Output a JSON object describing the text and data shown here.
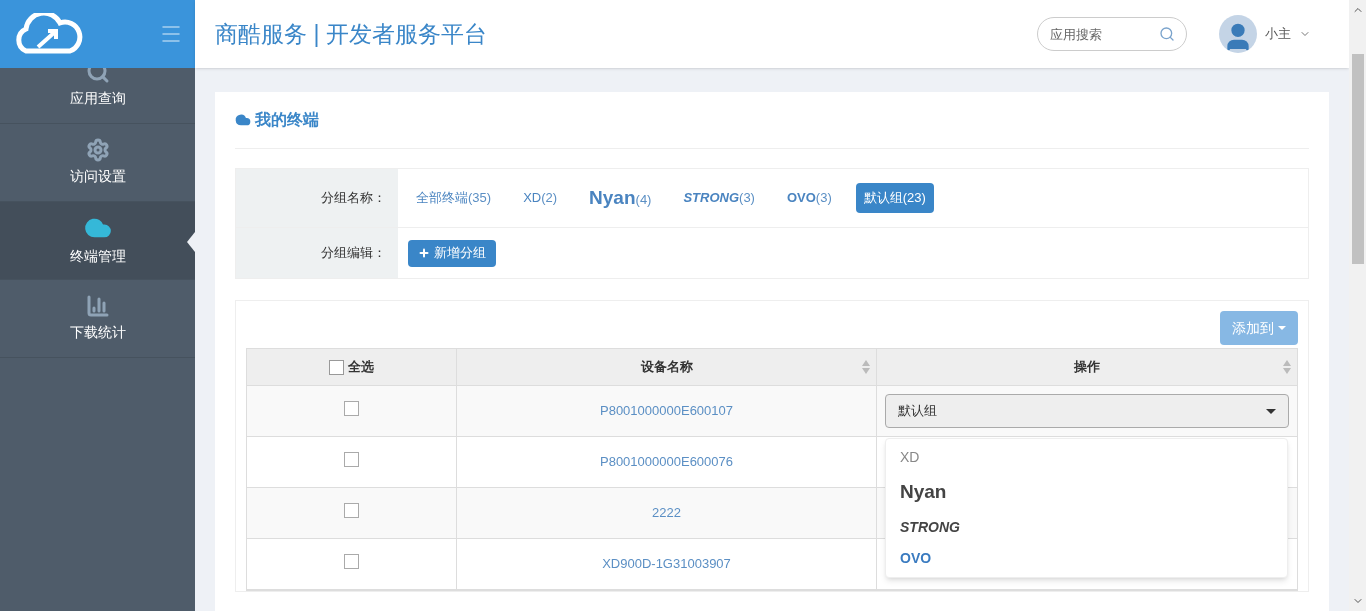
{
  "header": {
    "title": "商酷服务 | 开发者服务平台",
    "search": {
      "placeholder": "应用搜索"
    },
    "user": {
      "name": "小主"
    }
  },
  "sidebar": {
    "items": [
      {
        "label": "应用查询",
        "selected": false
      },
      {
        "label": "访问设置",
        "selected": false
      },
      {
        "label": "终端管理",
        "selected": true
      },
      {
        "label": "下载统计",
        "selected": false
      }
    ]
  },
  "panel": {
    "title": "我的终端",
    "filter": {
      "groups_label": "分组名称：",
      "edit_label": "分组编辑：",
      "add_button": "新增分组",
      "groups": [
        {
          "name": "全部终端",
          "count": "(35)",
          "kind": "plain",
          "selected": false
        },
        {
          "name": "XD",
          "count": "(2)",
          "kind": "plain",
          "selected": false
        },
        {
          "name": "Nyan",
          "count": "(4)",
          "kind": "large",
          "selected": false
        },
        {
          "name": "STRONG",
          "count": "(3)",
          "kind": "italic",
          "selected": false
        },
        {
          "name": "OVO",
          "count": "(3)",
          "kind": "bold",
          "selected": false
        },
        {
          "name": "默认组",
          "count": "(23)",
          "kind": "plain",
          "selected": true
        }
      ]
    },
    "add_to_button": "添加到",
    "table": {
      "columns": [
        "全选",
        "设备名称",
        "操作"
      ],
      "select_all_checked": false,
      "rows": [
        {
          "device": "P8001000000E600107",
          "checked": false
        },
        {
          "device": "P8001000000E600076",
          "checked": false
        },
        {
          "device": "2222",
          "checked": false
        },
        {
          "device": "XD900D-1G31003907",
          "checked": false
        }
      ],
      "group_select": {
        "value": "默认组",
        "open": true,
        "options": [
          {
            "label": "XD",
            "kind": "plain"
          },
          {
            "label": "Nyan",
            "kind": "large"
          },
          {
            "label": "STRONG",
            "kind": "italic"
          },
          {
            "label": "OVO",
            "kind": "bold"
          }
        ]
      }
    }
  }
}
